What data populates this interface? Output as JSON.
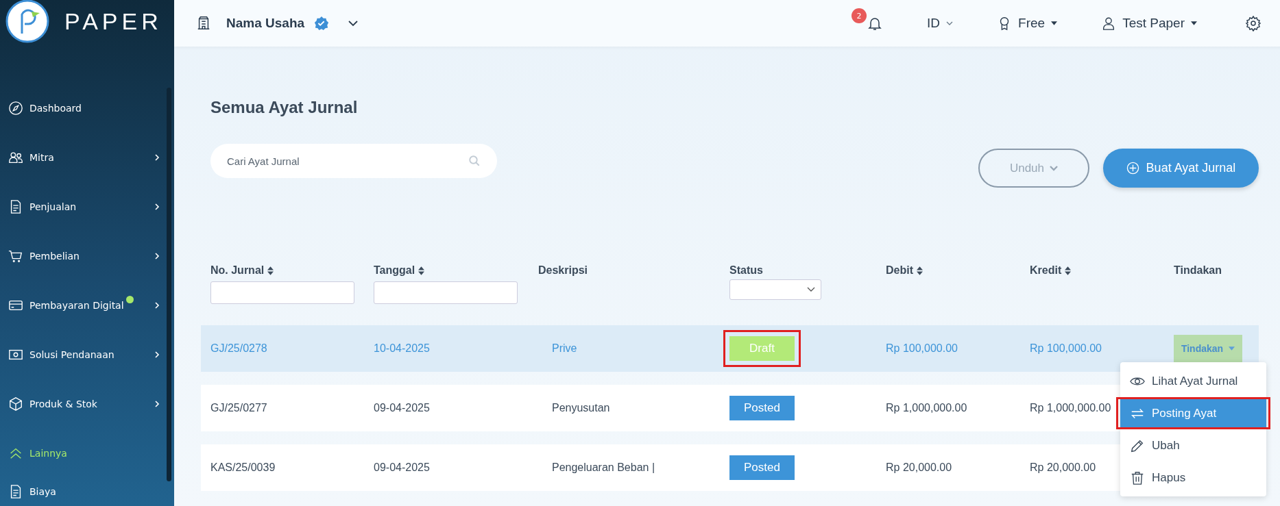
{
  "brand": {
    "name": "PAPER"
  },
  "sidebar": {
    "items": [
      {
        "label": "Dashboard",
        "has_submenu": false,
        "selected": false,
        "badge_dot": false
      },
      {
        "label": "Mitra",
        "has_submenu": true,
        "selected": false,
        "badge_dot": false
      },
      {
        "label": "Penjualan",
        "has_submenu": true,
        "selected": false,
        "badge_dot": false
      },
      {
        "label": "Pembelian",
        "has_submenu": true,
        "selected": false,
        "badge_dot": false
      },
      {
        "label": "Pembayaran Digital",
        "has_submenu": true,
        "selected": false,
        "badge_dot": true
      },
      {
        "label": "Solusi Pendanaan",
        "has_submenu": true,
        "selected": false,
        "badge_dot": false
      },
      {
        "label": "Produk & Stok",
        "has_submenu": true,
        "selected": false,
        "badge_dot": false
      },
      {
        "label": "Lainnya",
        "has_submenu": false,
        "selected": true,
        "badge_dot": false
      },
      {
        "label": "Biaya",
        "has_submenu": false,
        "selected": false,
        "badge_dot": false
      }
    ]
  },
  "topbar": {
    "business_name": "Nama Usaha",
    "verified": true,
    "notification_count": "2",
    "language": "ID",
    "plan": "Free",
    "user": "Test Paper"
  },
  "page": {
    "title": "Semua Ayat Jurnal",
    "search": {
      "placeholder": "Cari Ayat Jurnal"
    },
    "buttons": [
      {
        "label": "Unduh",
        "kind": "outline"
      },
      {
        "label": "Buat Ayat Jurnal",
        "kind": "primary"
      }
    ]
  },
  "table": {
    "columns": [
      {
        "label": "No. Jurnal",
        "sortable": true
      },
      {
        "label": "Tanggal",
        "sortable": true
      },
      {
        "label": "Deskripsi",
        "sortable": false
      },
      {
        "label": "Status",
        "sortable": false
      },
      {
        "label": "Debit",
        "sortable": true
      },
      {
        "label": "Kredit",
        "sortable": true
      },
      {
        "label": "Tindakan",
        "sortable": false
      }
    ],
    "rows": [
      {
        "number": "GJ/25/0278",
        "date": "10-04-2025",
        "description": "Prive",
        "status": {
          "label": "Draft",
          "kind": "draft",
          "highlighted": true
        },
        "debit": "Rp 100,000.00",
        "credit": "Rp 100,000.00",
        "action": "Tindakan",
        "selected": true
      },
      {
        "number": "GJ/25/0277",
        "date": "09-04-2025",
        "description": "Penyusutan",
        "status": {
          "label": "Posted",
          "kind": "posted",
          "highlighted": false
        },
        "debit": "Rp 1,000,000.00",
        "credit": "Rp 1,000,000.00",
        "selected": false
      },
      {
        "number": "KAS/25/0039",
        "date": "09-04-2025",
        "description": "Pengeluaran Beban |",
        "status": {
          "label": "Posted",
          "kind": "posted",
          "highlighted": false
        },
        "debit": "Rp 20,000.00",
        "credit": "Rp 20,000.00",
        "selected": false
      }
    ]
  },
  "action_menu": {
    "items": [
      {
        "label": "Lihat Ayat Jurnal",
        "selected": false,
        "highlighted": false
      },
      {
        "label": "Posting Ayat",
        "selected": true,
        "highlighted": true
      },
      {
        "label": "Ubah",
        "selected": false,
        "highlighted": false
      },
      {
        "label": "Hapus",
        "selected": false,
        "highlighted": false
      }
    ]
  }
}
